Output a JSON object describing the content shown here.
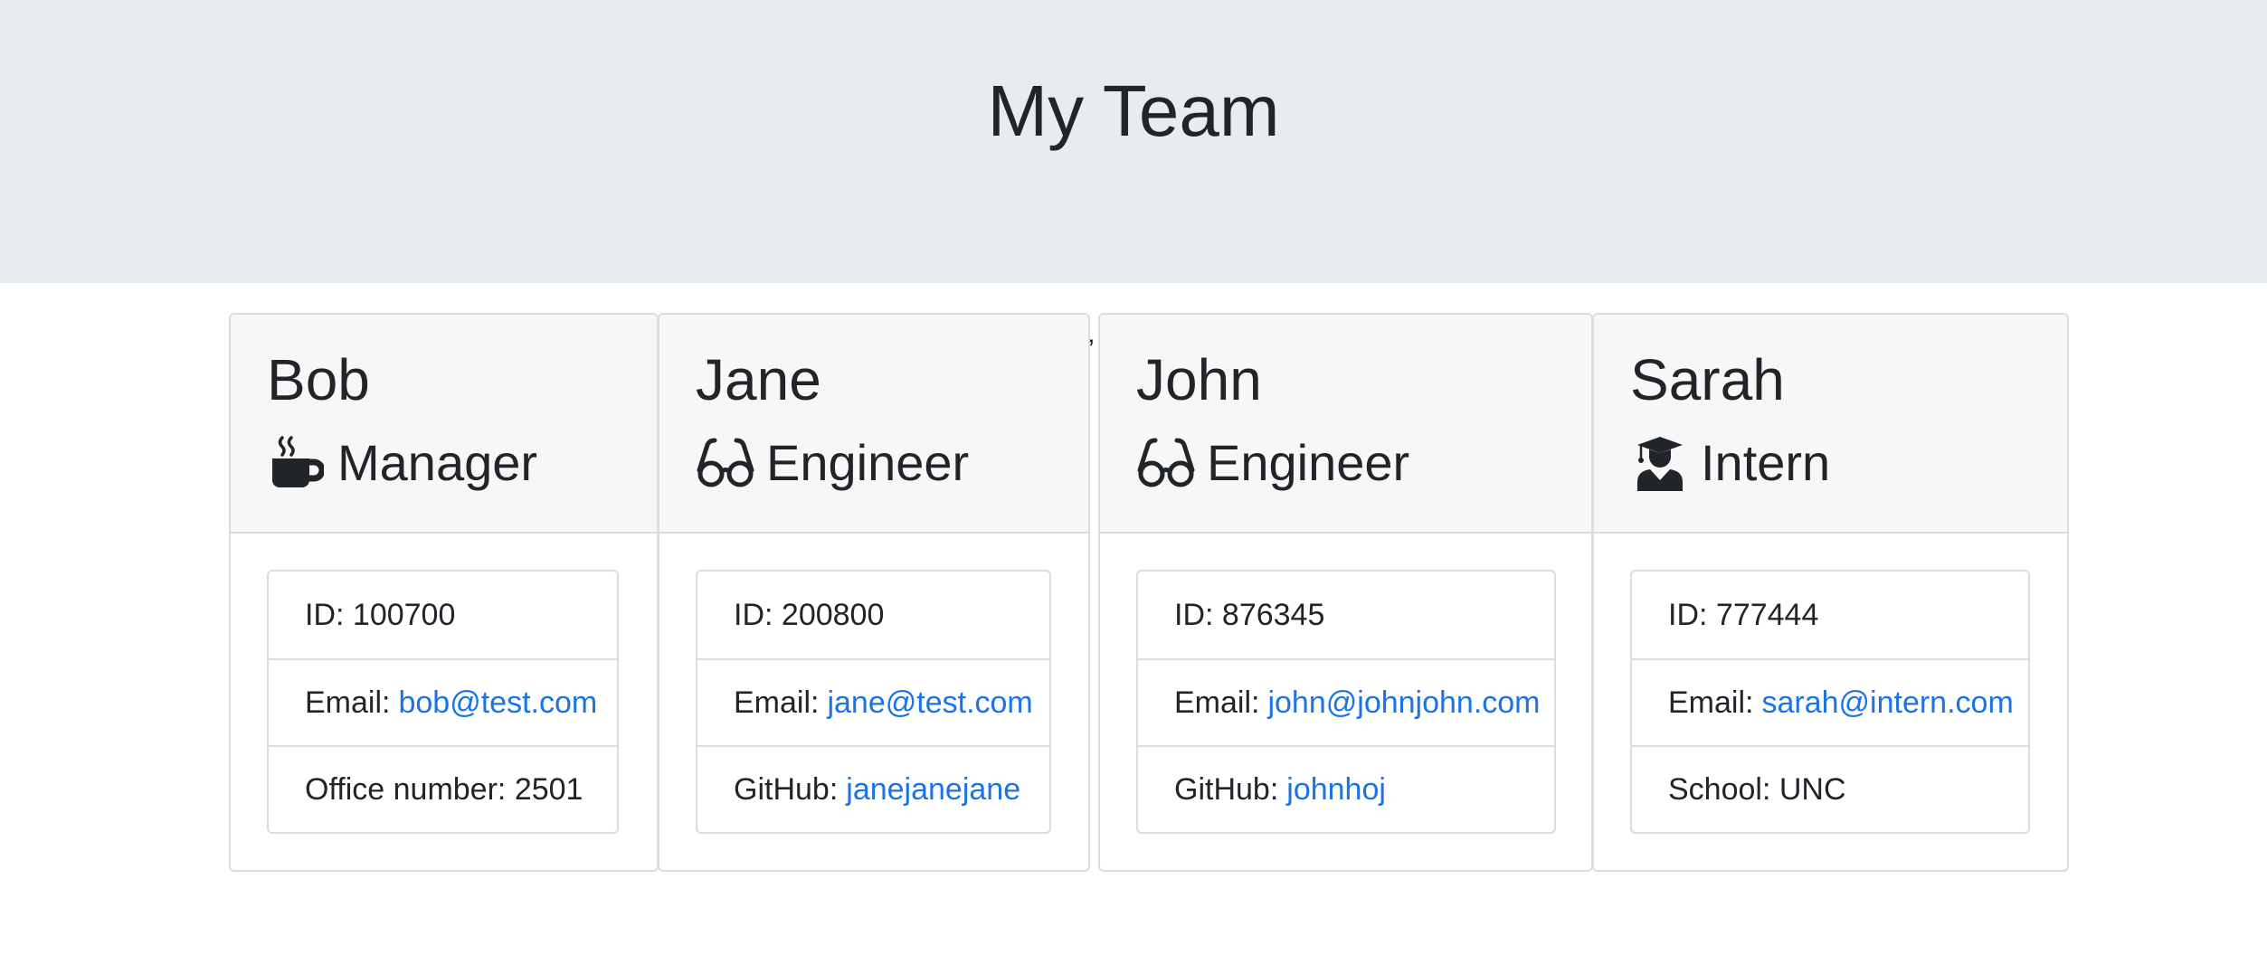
{
  "header": {
    "title": "My Team"
  },
  "employees": [
    {
      "name": "Bob",
      "role": "Manager",
      "icon": "coffee-icon",
      "id_label": "ID:",
      "id": "100700",
      "email_label": "Email:",
      "email": "bob@test.com",
      "extra_label": "Office number:",
      "extra_value": "2501"
    },
    {
      "name": "Jane",
      "role": "Engineer",
      "icon": "glasses-icon",
      "id_label": "ID:",
      "id": "200800",
      "email_label": "Email:",
      "email": "jane@test.com",
      "extra_label": "GitHub:",
      "extra_value": "janejanejane"
    },
    {
      "name": "John",
      "role": "Engineer",
      "icon": "glasses-icon",
      "id_label": "ID:",
      "id": "876345",
      "email_label": "Email:",
      "email": "john@johnjohn.com",
      "extra_label": "GitHub:",
      "extra_value": "johnhoj"
    },
    {
      "name": "Sarah",
      "role": "Intern",
      "icon": "graduate-icon",
      "id_label": "ID:",
      "id": "777444",
      "email_label": "Email:",
      "email": "sarah@intern.com",
      "extra_label": "School:",
      "extra_value": "UNC"
    }
  ],
  "stray_mark": "’",
  "colors": {
    "header_bg": "#e9ecef",
    "link": "#1a73e8",
    "card_header_bg": "#f7f7f7"
  }
}
